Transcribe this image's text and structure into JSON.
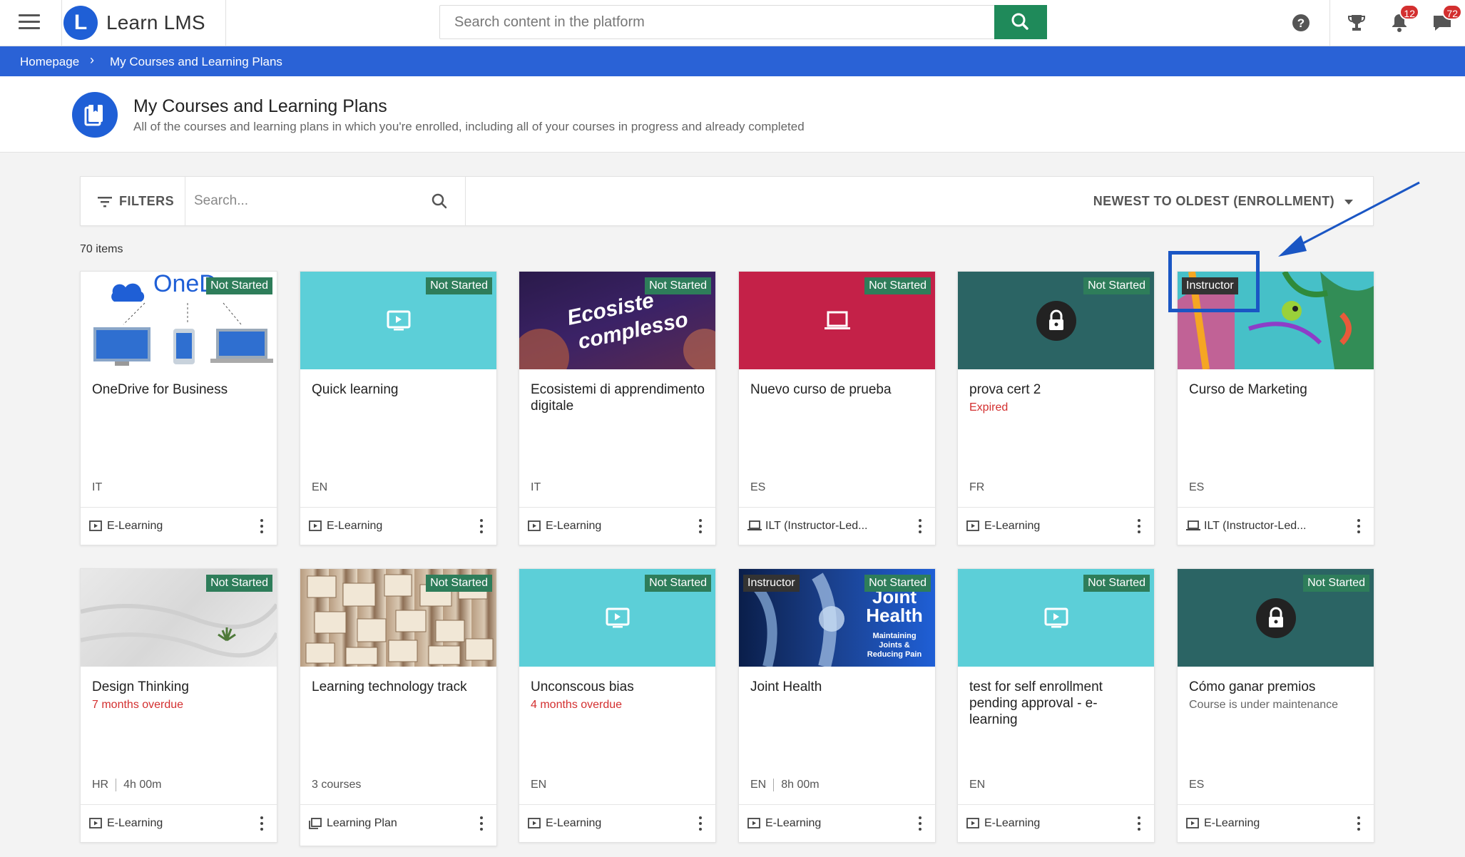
{
  "app": {
    "name": "Learn LMS",
    "logo_letter": "L"
  },
  "search": {
    "placeholder": "Search content in the platform"
  },
  "notifications": {
    "count": "12"
  },
  "messages": {
    "count": "72"
  },
  "breadcrumb": {
    "home": "Homepage",
    "current": "My Courses and Learning Plans"
  },
  "page": {
    "title": "My Courses and Learning Plans",
    "subtitle": "All of the courses and learning plans in which you're enrolled, including all of your courses in progress and already completed"
  },
  "filterbar": {
    "filters_label": "FILTERS",
    "search_placeholder": "Search...",
    "sort_label": "NEWEST TO OLDEST (ENROLLMENT)"
  },
  "items_count": "70 items",
  "cards": [
    {
      "title": "OneDrive for Business",
      "status": "Not Started",
      "role": "",
      "note": "",
      "meta_lang": "IT",
      "meta_extra": "",
      "type": "E-Learning",
      "type_icon": "play-icon",
      "thumb_art": "OneD"
    },
    {
      "title": "Quick learning",
      "status": "Not Started",
      "role": "",
      "note": "",
      "meta_lang": "EN",
      "meta_extra": "",
      "type": "E-Learning",
      "type_icon": "play-icon"
    },
    {
      "title": "Ecosistemi di apprendimento digitale",
      "status": "Not Started",
      "role": "",
      "note": "",
      "meta_lang": "IT",
      "meta_extra": "",
      "type": "E-Learning",
      "type_icon": "play-icon",
      "thumb_art_line1": "Ecosiste",
      "thumb_art_line2": "complesso"
    },
    {
      "title": "Nuevo curso de prueba",
      "status": "Not Started",
      "role": "",
      "note": "",
      "meta_lang": "ES",
      "meta_extra": "",
      "type": "ILT (Instructor-Led...",
      "type_icon": "laptop-icon"
    },
    {
      "title": "prova cert 2",
      "status": "Not Started",
      "role": "",
      "note": "Expired",
      "meta_lang": "FR",
      "meta_extra": "",
      "type": "E-Learning",
      "type_icon": "play-icon"
    },
    {
      "title": "Curso de Marketing",
      "status": "",
      "role": "Instructor",
      "note": "",
      "meta_lang": "ES",
      "meta_extra": "",
      "type": "ILT (Instructor-Led...",
      "type_icon": "laptop-icon"
    },
    {
      "title": "Design Thinking",
      "status": "Not Started",
      "role": "",
      "note": "7 months overdue",
      "meta_lang": "HR",
      "meta_extra": "4h 00m",
      "type": "E-Learning",
      "type_icon": "play-icon"
    },
    {
      "title": "Learning technology track",
      "status": "Not Started",
      "role": "",
      "note": "",
      "meta_lang": "3 courses",
      "meta_extra": "",
      "type": "Learning Plan",
      "type_icon": "learning-plan-icon"
    },
    {
      "title": "Unconscous bias",
      "status": "Not Started",
      "role": "",
      "note": "4 months overdue",
      "meta_lang": "EN",
      "meta_extra": "",
      "type": "E-Learning",
      "type_icon": "play-icon"
    },
    {
      "title": "Joint Health",
      "status": "Not Started",
      "role": "Instructor",
      "note": "",
      "meta_lang": "EN",
      "meta_extra": "8h 00m",
      "type": "E-Learning",
      "type_icon": "play-icon",
      "thumb_art_line1": "Joint",
      "thumb_art_line2": "Health",
      "thumb_art_line3": "Maintaining",
      "thumb_art_line4": "Joints &",
      "thumb_art_line5": "Reducing Pain"
    },
    {
      "title": "test for self enrollment pending approval - e-learning",
      "status": "Not Started",
      "role": "",
      "note": "",
      "meta_lang": "EN",
      "meta_extra": "",
      "type": "E-Learning",
      "type_icon": "play-icon"
    },
    {
      "title": "Cómo ganar premios",
      "status": "Not Started",
      "role": "",
      "note": "Course is under maintenance",
      "meta_lang": "ES",
      "meta_extra": "",
      "type": "E-Learning",
      "type_icon": "play-icon"
    }
  ],
  "colors": {
    "primary": "#1f5fd6",
    "breadcrumb": "#2a62d6",
    "search_button": "#1f8a5a",
    "status_badge": "#2e7d5a",
    "overdue": "#d32f2f"
  }
}
